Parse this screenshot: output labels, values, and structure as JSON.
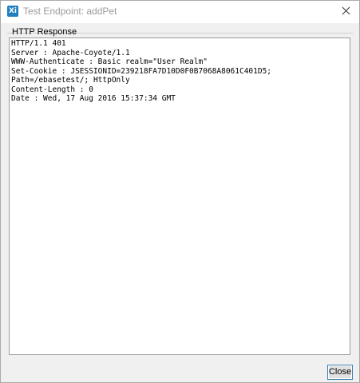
{
  "window": {
    "title": "Test Endpoint: addPet",
    "app_icon_text": "Xi"
  },
  "group": {
    "label": "HTTP Response"
  },
  "response": {
    "lines": [
      "HTTP/1.1 401",
      "Server : Apache-Coyote/1.1",
      "WWW-Authenticate : Basic realm=\"User Realm\"",
      "Set-Cookie : JSESSIONID=239218FA7D10D0F0B7068A8061C401D5;",
      "Path=/ebasetest/; HttpOnly",
      "Content-Length : 0",
      "Date : Wed, 17 Aug 2016 15:37:34 GMT"
    ]
  },
  "buttons": {
    "close_label": "Close"
  }
}
